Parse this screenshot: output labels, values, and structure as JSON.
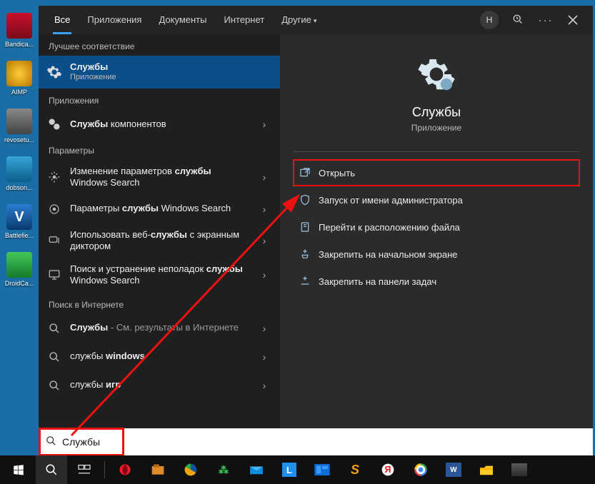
{
  "desktop": [
    {
      "label": "Bandica...",
      "color": "#c8102e"
    },
    {
      "label": "AIMP",
      "color": "#f5a300"
    },
    {
      "label": "revosetu...",
      "color": "#5a5a5a"
    },
    {
      "label": "dobson...",
      "color": "#1e90c8"
    },
    {
      "label": "Battlefie...",
      "color": "#1d6fb8"
    },
    {
      "label": "DroidCa...",
      "color": "#2aa84a"
    }
  ],
  "tabs": {
    "items": [
      "Все",
      "Приложения",
      "Документы",
      "Интернет",
      "Другие"
    ],
    "active_index": 0,
    "avatar": "Н"
  },
  "sections": {
    "best_match": "Лучшее соответствие",
    "apps": "Приложения",
    "settings": "Параметры",
    "web": "Поиск в Интернете"
  },
  "best_match": {
    "title": "Службы",
    "subtitle": "Приложение"
  },
  "apps": [
    {
      "pre": "Службы",
      "post": " компонентов"
    }
  ],
  "settings": [
    {
      "pre": "Изменение параметров ",
      "bold": "службы",
      "post": " Windows Search"
    },
    {
      "pre": "Параметры ",
      "bold": "службы",
      "post": " Windows Search"
    },
    {
      "pre": "Использовать веб-",
      "bold": "службы",
      "post": " с экранным диктором"
    },
    {
      "pre": "Поиск и устранение неполадок ",
      "bold": "службы",
      "post": " Windows Search"
    }
  ],
  "web": [
    {
      "pre": "",
      "bold": "Службы",
      "post": " - См. результаты в Интернете"
    },
    {
      "pre": "службы ",
      "bold": "windows",
      "post": ""
    },
    {
      "pre": "службы ",
      "bold": "игр",
      "post": ""
    }
  ],
  "preview": {
    "title": "Службы",
    "subtitle": "Приложение",
    "actions": [
      "Открыть",
      "Запуск от имени администратора",
      "Перейти к расположению файла",
      "Закрепить на начальном экране",
      "Закрепить на панели задач"
    ]
  },
  "search_value": "Службы"
}
